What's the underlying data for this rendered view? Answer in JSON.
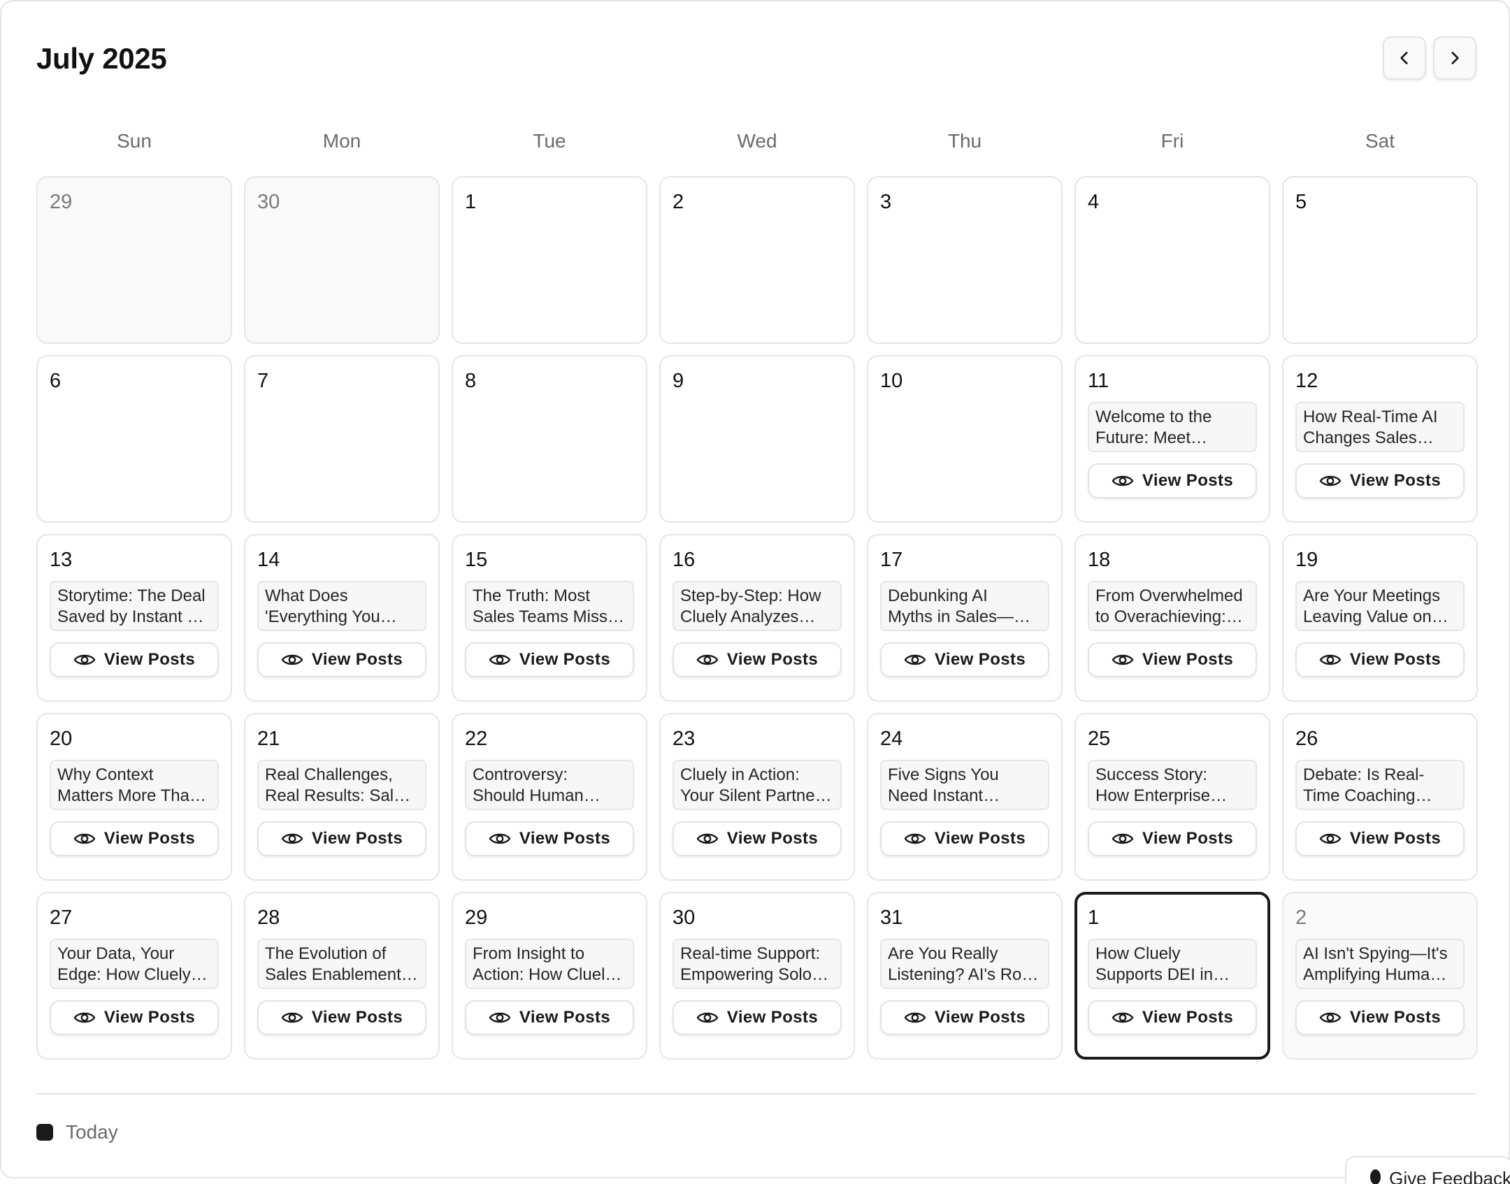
{
  "header": {
    "title": "July 2025"
  },
  "weekdays": [
    "Sun",
    "Mon",
    "Tue",
    "Wed",
    "Thu",
    "Fri",
    "Sat"
  ],
  "view_posts_label": "View Posts",
  "legend": {
    "today_label": "Today"
  },
  "feedback": {
    "label": "Give Feedback"
  },
  "colors": {
    "today_border": "#1a1a1a",
    "cell_border": "#e6e6e6",
    "muted_text": "#6b6b6b"
  },
  "days": [
    {
      "day": "29",
      "outside": true
    },
    {
      "day": "30",
      "outside": true
    },
    {
      "day": "1"
    },
    {
      "day": "2"
    },
    {
      "day": "3"
    },
    {
      "day": "4"
    },
    {
      "day": "5"
    },
    {
      "day": "6"
    },
    {
      "day": "7"
    },
    {
      "day": "8"
    },
    {
      "day": "9"
    },
    {
      "day": "10"
    },
    {
      "day": "11",
      "post": [
        "Welcome to the",
        "Future: Meet…"
      ]
    },
    {
      "day": "12",
      "post": [
        "How Real-Time AI",
        "Changes Sales…"
      ]
    },
    {
      "day": "13",
      "post": [
        "Storytime: The Deal",
        "Saved by Instant …"
      ]
    },
    {
      "day": "14",
      "post": [
        "What Does",
        "'Everything You…"
      ]
    },
    {
      "day": "15",
      "post": [
        "The Truth: Most",
        "Sales Teams Miss…"
      ]
    },
    {
      "day": "16",
      "post": [
        "Step-by-Step: How",
        "Cluely Analyzes…"
      ]
    },
    {
      "day": "17",
      "post": [
        "Debunking AI",
        "Myths in Sales—…"
      ]
    },
    {
      "day": "18",
      "post": [
        "From Overwhelmed",
        "to Overachieving:…"
      ]
    },
    {
      "day": "19",
      "post": [
        "Are Your Meetings",
        "Leaving Value on…"
      ]
    },
    {
      "day": "20",
      "post": [
        "Why Context",
        "Matters More Tha…"
      ]
    },
    {
      "day": "21",
      "post": [
        "Real Challenges,",
        "Real Results: Sale…"
      ]
    },
    {
      "day": "22",
      "post": [
        "Controversy:",
        "Should Human…"
      ]
    },
    {
      "day": "23",
      "post": [
        "Cluely in Action:",
        "Your Silent Partne…"
      ]
    },
    {
      "day": "24",
      "post": [
        "Five Signs You",
        "Need Instant…"
      ]
    },
    {
      "day": "25",
      "post": [
        "Success Story:",
        "How Enterprise…"
      ]
    },
    {
      "day": "26",
      "post": [
        "Debate: Is Real-",
        "Time Coaching…"
      ]
    },
    {
      "day": "27",
      "post": [
        "Your Data, Your",
        "Edge: How Cluely…"
      ]
    },
    {
      "day": "28",
      "post": [
        "The Evolution of",
        "Sales Enablement…"
      ]
    },
    {
      "day": "29",
      "post": [
        "From Insight to",
        "Action: How Cluel…"
      ]
    },
    {
      "day": "30",
      "post": [
        "Real-time Support:",
        "Empowering Solo…"
      ]
    },
    {
      "day": "31",
      "post": [
        "Are You Really",
        "Listening? AI's Rol…"
      ]
    },
    {
      "day": "1",
      "today": true,
      "post": [
        "How Cluely",
        "Supports DEI in…"
      ]
    },
    {
      "day": "2",
      "outside": true,
      "post": [
        "AI Isn't Spying—It's",
        "Amplifying Huma…"
      ]
    }
  ]
}
